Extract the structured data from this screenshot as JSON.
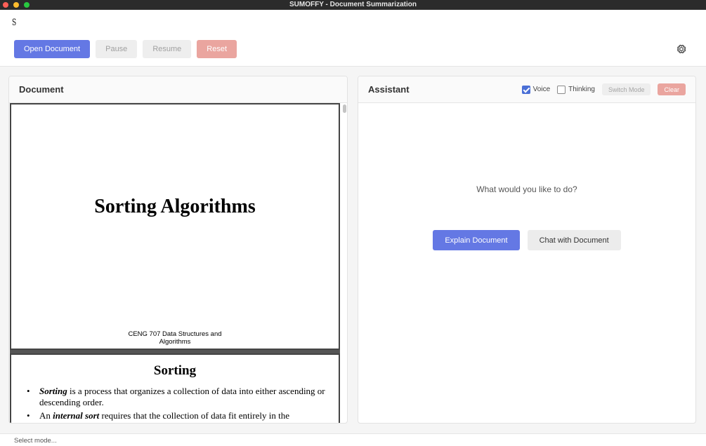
{
  "window": {
    "title": "SUMOFFY - Document Summarization"
  },
  "app": {
    "logo_text": "S"
  },
  "toolbar": {
    "open_label": "Open Document",
    "pause_label": "Pause",
    "resume_label": "Resume",
    "reset_label": "Reset",
    "settings_icon": "gear-icon"
  },
  "document_panel": {
    "title": "Document",
    "pages": {
      "slide1": {
        "title": "Sorting Algorithms",
        "subtitle_line1": "CENG 707 Data Structures and",
        "subtitle_line2": "Algorithms"
      },
      "slide2": {
        "title": "Sorting",
        "bullet1_term": "Sorting",
        "bullet1_rest": " is a process that organizes a collection of data into either ascending or descending order.",
        "bullet2_pre": "An ",
        "bullet2_term": "internal sort",
        "bullet2_rest": " requires that the collection of data fit entirely in the"
      }
    }
  },
  "assistant_panel": {
    "title": "Assistant",
    "voice_label": "Voice",
    "voice_checked": true,
    "thinking_label": "Thinking",
    "thinking_checked": false,
    "switch_mode_label": "Switch Mode",
    "clear_label": "Clear",
    "prompt": "What would you like to do?",
    "explain_label": "Explain Document",
    "chat_label": "Chat with Document"
  },
  "status": {
    "text": "Select mode..."
  },
  "colors": {
    "primary": "#6478e4",
    "danger": "#eaa59f",
    "checkbox": "#4a6fd6",
    "titlebar": "#2b2b2b"
  }
}
